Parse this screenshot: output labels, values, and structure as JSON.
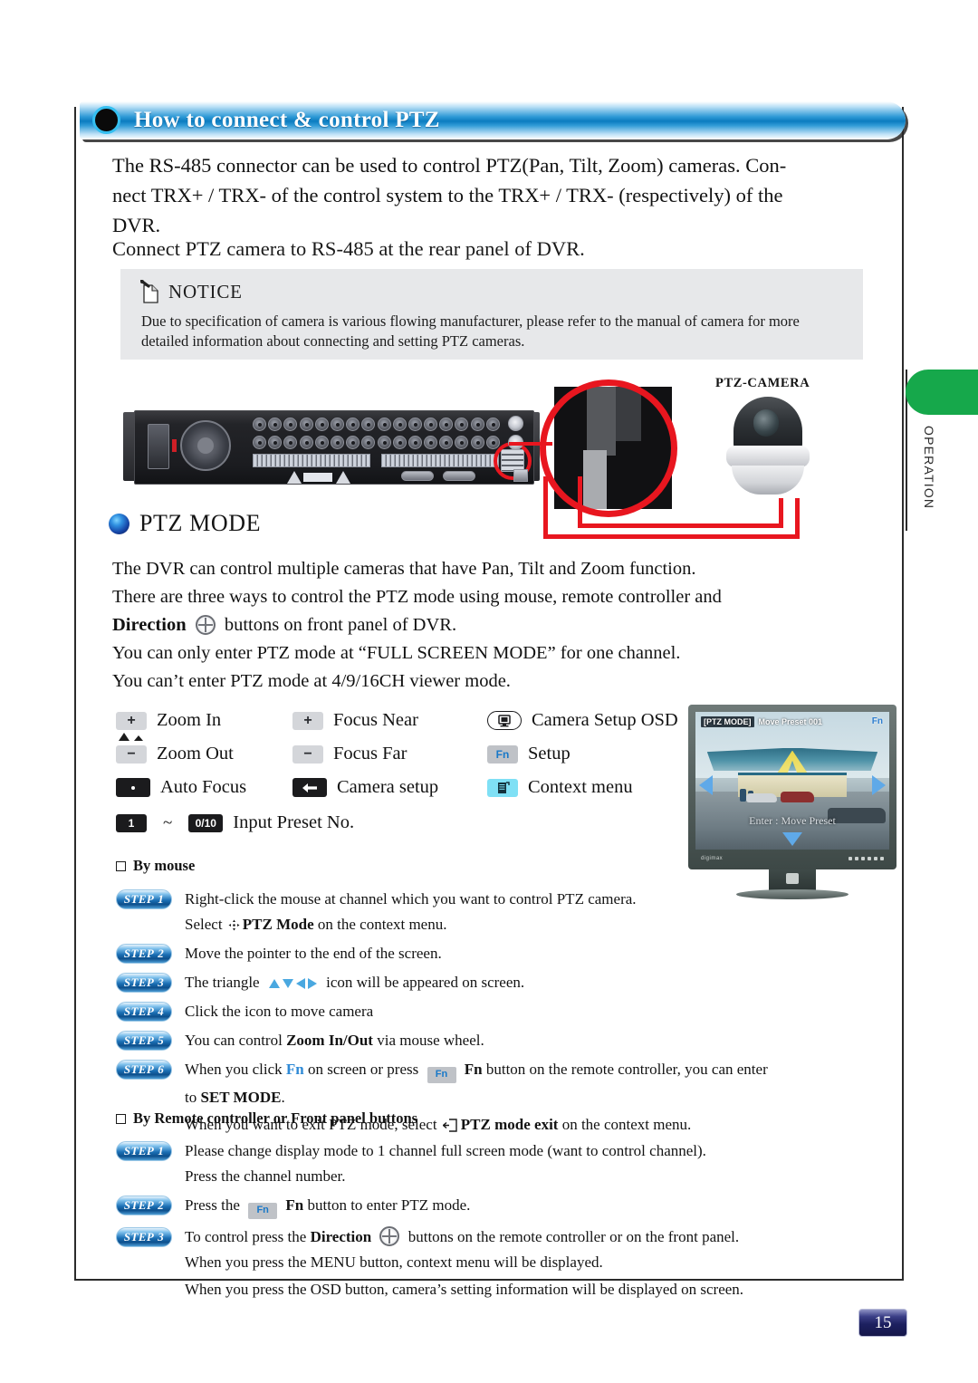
{
  "header": {
    "title": "How to connect & control PTZ"
  },
  "intro": {
    "line1": "The RS-485 connector can be used to control PTZ(Pan, Tilt, Zoom) cameras. Con-",
    "line2": "nect TRX+ / TRX- of the control system to the TRX+ / TRX- (respectively) of the",
    "line3": "DVR.",
    "line4": "Connect PTZ camera to RS-485 at the rear panel of DVR."
  },
  "notice": {
    "title": "NOTICE",
    "body_line1": "Due to specification of camera is various flowing manufacturer, please refer to the manual of",
    "body_line2": "camera for more detailed information about connecting and setting PTZ cameras."
  },
  "illustration": {
    "camera_label": "PTZ-CAMERA"
  },
  "ptz_mode": {
    "heading": "PTZ MODE",
    "line1": "The DVR can control multiple cameras that have Pan, Tilt and Zoom function.",
    "line2": "There are three ways to control the PTZ mode using mouse, remote controller and",
    "line3_bold": "Direction",
    "line3_rest": "buttons on front panel of DVR.",
    "line4": "You can only enter PTZ mode at “FULL SCREEN MODE” for one channel.",
    "line5": "You can’t enter PTZ mode at 4/9/16CH viewer mode."
  },
  "legend": {
    "zoom_in": {
      "key": "+",
      "label": "Zoom  In"
    },
    "zoom_out": {
      "key": "−",
      "label": "Zoom  Out"
    },
    "auto_focus": {
      "key": "·",
      "label": "Auto Focus"
    },
    "focus_near": {
      "key": "+",
      "label": "Focus Near"
    },
    "focus_far": {
      "key": "−",
      "label": "Focus Far"
    },
    "camera_setup": {
      "key": "←",
      "label": "Camera setup"
    },
    "camera_setup_osd": {
      "key": "❐",
      "label": "Camera Setup OSD"
    },
    "setup": {
      "key": "Fn",
      "label": "Setup"
    },
    "context_menu": {
      "key": "☰",
      "label": "Context menu"
    },
    "preset": {
      "key_from": "1",
      "tilde": "~",
      "key_to": "0/10",
      "label": "Input Preset No."
    }
  },
  "monitor": {
    "osd_mode_tag": "[PTZ MODE]",
    "osd_preset_text": "Move Preset 001",
    "osd_fn": "Fn",
    "osd_enter": "Enter : Move Preset",
    "brand": "digimax"
  },
  "by_mouse": {
    "title": "By mouse",
    "steps": [
      {
        "badge_word": "STEP",
        "badge_num": "1",
        "text": "Right-click the mouse at channel which you want to control PTZ camera.",
        "cont_pre": "Select",
        "cont_bold": "PTZ Mode",
        "cont_post": "on the context menu."
      },
      {
        "badge_word": "STEP",
        "badge_num": "2",
        "text": "Move the pointer to the end of the screen."
      },
      {
        "badge_word": "STEP",
        "badge_num": "3",
        "text_pre": "The triangle",
        "text_post": "icon will be appeared on screen."
      },
      {
        "badge_word": "STEP",
        "badge_num": "4",
        "text": "Click the icon to move camera"
      },
      {
        "badge_word": "STEP",
        "badge_num": "5",
        "text_pre": "You can control",
        "text_bold": "Zoom In/Out",
        "text_post": "via mouse wheel."
      },
      {
        "badge_word": "STEP",
        "badge_num": "6",
        "text_pre": "When you click",
        "text_fn": "Fn",
        "text_mid": "on screen or press",
        "text_fn_bold": "Fn",
        "text_post": "button on the remote controller, you can enter",
        "cont_pre": "to",
        "cont_bold": "SET MODE",
        "cont_post": ".",
        "cont2_pre": "When you want to exit PTZ mode, select",
        "cont2_bold": "PTZ mode exit",
        "cont2_post": "on the context menu."
      }
    ]
  },
  "by_remote": {
    "title": "By Remote controller or Front panel buttons",
    "steps": [
      {
        "badge_word": "STEP",
        "badge_num": "1",
        "text": "Please change display mode to 1 channel full screen mode (want to control channel).",
        "cont": "Press the channel number."
      },
      {
        "badge_word": "STEP",
        "badge_num": "2",
        "text_pre": "Press the",
        "text_fn_bold": "Fn",
        "text_post": "button to enter PTZ mode."
      },
      {
        "badge_word": "STEP",
        "badge_num": "3",
        "text_pre": "To control press the",
        "text_bold": "Direction",
        "text_post": "buttons on the remote controller or on the front panel.",
        "cont": "When you press the MENU button, context menu will be displayed.",
        "cont2": "When you press the OSD button, camera’s setting information will be displayed on screen."
      }
    ]
  },
  "side_tab": {
    "label": "OPERATION"
  },
  "footer": {
    "page_number": "15"
  },
  "colors": {
    "header_blue": "#0b7cc0",
    "accent_red": "#e8161f",
    "tab_green": "#16a84b",
    "step_blue": "#1a6fb5",
    "page_navy": "#1d2060"
  }
}
